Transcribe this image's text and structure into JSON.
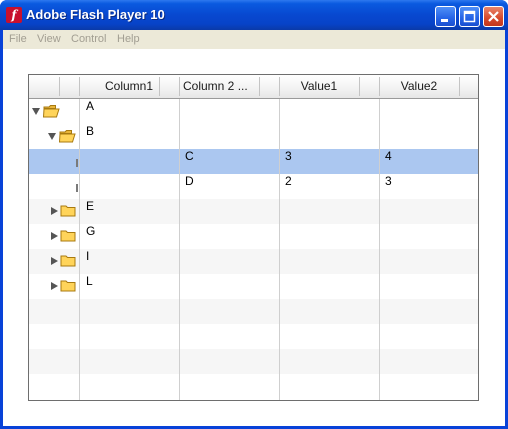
{
  "window": {
    "title": "Adobe Flash Player 10",
    "app_icon_glyph": "f"
  },
  "menu": {
    "items": [
      "File",
      "View",
      "Control",
      "Help"
    ],
    "color": "#a29e92"
  },
  "grid": {
    "columns": [
      "Column1",
      "Column 2 ...",
      "Value1",
      "Value2"
    ],
    "selection_color": "#abc7f0",
    "rows": [
      {
        "label": "A",
        "col2": "",
        "value1": "",
        "value2": "",
        "type": "folder",
        "state": "expanded",
        "level": 0
      },
      {
        "label": "B",
        "col2": "",
        "value1": "",
        "value2": "",
        "type": "folder",
        "state": "expanded",
        "level": 1
      },
      {
        "label": "",
        "col2": "C",
        "value1": "3",
        "value2": "4",
        "type": "leaf",
        "level": 2,
        "selected": true
      },
      {
        "label": "",
        "col2": "D",
        "value1": "2",
        "value2": "3",
        "type": "leaf",
        "level": 2
      },
      {
        "label": "E",
        "col2": "",
        "value1": "",
        "value2": "",
        "type": "folder",
        "state": "collapsed",
        "level": 1
      },
      {
        "label": "G",
        "col2": "",
        "value1": "",
        "value2": "",
        "type": "folder",
        "state": "collapsed",
        "level": 1
      },
      {
        "label": "I",
        "col2": "",
        "value1": "",
        "value2": "",
        "type": "folder",
        "state": "collapsed",
        "level": 1
      },
      {
        "label": "L",
        "col2": "",
        "value1": "",
        "value2": "",
        "type": "folder",
        "state": "collapsed",
        "level": 1
      }
    ]
  }
}
